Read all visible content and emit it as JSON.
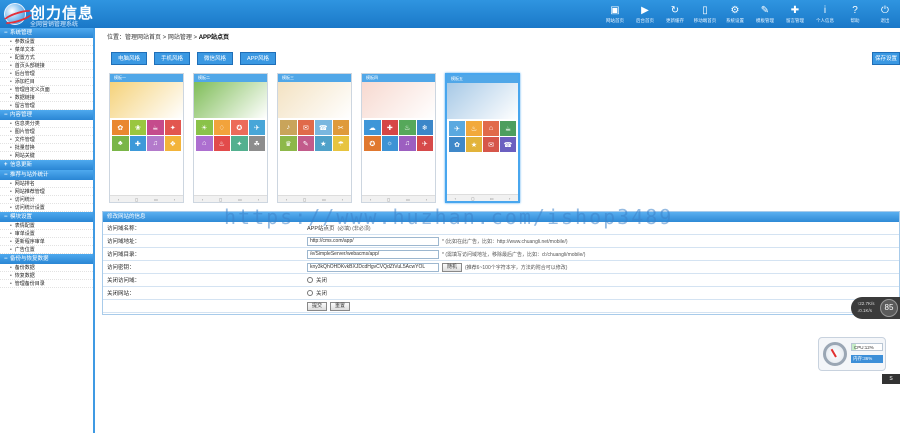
{
  "brand": {
    "name": "创力信息",
    "tagline": "全网营销管理系统"
  },
  "topnav": [
    {
      "icon": "▣",
      "label": "网站首页"
    },
    {
      "icon": "▶",
      "label": "后台首页"
    },
    {
      "icon": "↻",
      "label": "更新缓存"
    },
    {
      "icon": "▯",
      "label": "移动端首页"
    },
    {
      "icon": "⚙",
      "label": "系统设置"
    },
    {
      "icon": "✎",
      "label": "模板管理"
    },
    {
      "icon": "✚",
      "label": "留言管理"
    },
    {
      "icon": "i",
      "label": "个人信息"
    },
    {
      "icon": "?",
      "label": "帮助"
    },
    {
      "icon": "⏻",
      "label": "退出"
    }
  ],
  "sidebar": [
    {
      "title": "系统管理",
      "toggle": "−",
      "items": [
        "参数设置",
        "菜单文本",
        "配置方式",
        "首页头部链接",
        "后台管理",
        "添加栏目",
        "管理自定义页面",
        "数据链接",
        "留言管理"
      ]
    },
    {
      "title": "内容管理",
      "toggle": "−",
      "items": [
        "信息类分类",
        "图片管理",
        "文件管理",
        "批量替换",
        "网站关键"
      ]
    },
    {
      "title": "信息更新",
      "toggle": "+",
      "items": []
    },
    {
      "title": "推荐与站外统计",
      "toggle": "−",
      "items": [
        "网站排名",
        "网站推荐管理",
        "访问统计",
        "访问统计设置"
      ]
    },
    {
      "title": "模块设置",
      "toggle": "−",
      "items": [
        "表情配置",
        "审单设置",
        "更新程序审单",
        "广告位置"
      ]
    },
    {
      "title": "备份与恢复数据",
      "toggle": "−",
      "items": [
        "备份数据",
        "恢复数据",
        "管理备份目录"
      ]
    }
  ],
  "breadcrumb": {
    "prefix": "位置：管理网站首页 > 网站管理 > ",
    "current": "APP站点页"
  },
  "tabs": [
    "电脑风格",
    "手机风格",
    "微信风格",
    "APP风格"
  ],
  "right_button": "保存设置",
  "templates": [
    {
      "header": "模板一",
      "hero": "#f5d27a",
      "selected": false,
      "cells": [
        "✿",
        "❀",
        "☕",
        "✦",
        "♣",
        "✚",
        "♫",
        "❖"
      ],
      "colors": [
        "#e9872f",
        "#9ac63f",
        "#c54b8c",
        "#e2564f",
        "#7ab648",
        "#3d99d9",
        "#b37acb",
        "#f3b43a"
      ]
    },
    {
      "header": "模板二",
      "hero": "#7fbd58",
      "selected": false,
      "cells": [
        "☀",
        "♢",
        "✪",
        "✈",
        "⌂",
        "♨",
        "✦",
        "☘"
      ],
      "colors": [
        "#8ac249",
        "#f2a33b",
        "#ec6b5a",
        "#48a6d8",
        "#ad6fd0",
        "#e24b4b",
        "#53b08f",
        "#8d8d8d"
      ]
    },
    {
      "header": "模板三",
      "hero": "#f3e2c2",
      "selected": false,
      "cells": [
        "♪",
        "✉",
        "☎",
        "✂",
        "♛",
        "✎",
        "★",
        "☂"
      ],
      "colors": [
        "#c9a45a",
        "#e06a4a",
        "#7ab7df",
        "#df9a3b",
        "#8db84a",
        "#c25b8b",
        "#4fa1c9",
        "#e7c43f"
      ]
    },
    {
      "header": "模板四",
      "hero": "#f7d9d0",
      "selected": false,
      "cells": [
        "☁",
        "✚",
        "♨",
        "❄",
        "✪",
        "☼",
        "♫",
        "✈"
      ],
      "colors": [
        "#3e96d8",
        "#d64646",
        "#56a85a",
        "#3c87c9",
        "#e0782f",
        "#3d93d5",
        "#9c5fc0",
        "#d64a4a"
      ]
    },
    {
      "header": "模板五",
      "hero": "#a7c9e6",
      "selected": true,
      "cells": [
        "✈",
        "♨",
        "⌂",
        "☕",
        "✿",
        "★",
        "✉",
        "☎"
      ],
      "colors": [
        "#5aa9e0",
        "#f2a93b",
        "#e16a4a",
        "#4d9e5e",
        "#3f88c9",
        "#e2b33a",
        "#d6564a",
        "#6b5fc0"
      ]
    }
  ],
  "form": {
    "title": "修改网站的信息",
    "rows": [
      {
        "label": "访问域名称：",
        "value": "APP站点页",
        "hint": "(必填)  (非必须)"
      },
      {
        "label": "访问域地址：",
        "input": "http://cms.com/app/",
        "hint": "* (比如在此广告，比如：http://www.chuangli.net/mobile/)"
      },
      {
        "label": "访问域目录：",
        "input": "/e/SimpleServer/webacms/app/",
        "hint": "* (需填写访问域地址，移除最后广告，比如：d:/chuangli/mobile/)"
      },
      {
        "label": "访问密钥：",
        "input": "kny3kQhOHDKvkBXJDcdHgvCVQdZtVuL5AcwYOL",
        "button": "随机",
        "hint": "(推荐6~100个字符本字，方法的附合可以修改)"
      },
      {
        "label": "关闭访问域：",
        "radio": "关闭"
      },
      {
        "label": "关闭网站：",
        "radio": "关闭"
      }
    ],
    "buttons": [
      "提交",
      "重置"
    ]
  },
  "watermark": "https://www.huzhan.com/ishop3489",
  "widgets": {
    "speed": {
      "up": "↑22.7K/s",
      "down": "↓0.1K/s",
      "value": "85"
    },
    "system": {
      "cpu_label": "CPU:12%",
      "cpu_percent": 12,
      "mem_label": "内存:36%"
    },
    "corner": "S"
  }
}
